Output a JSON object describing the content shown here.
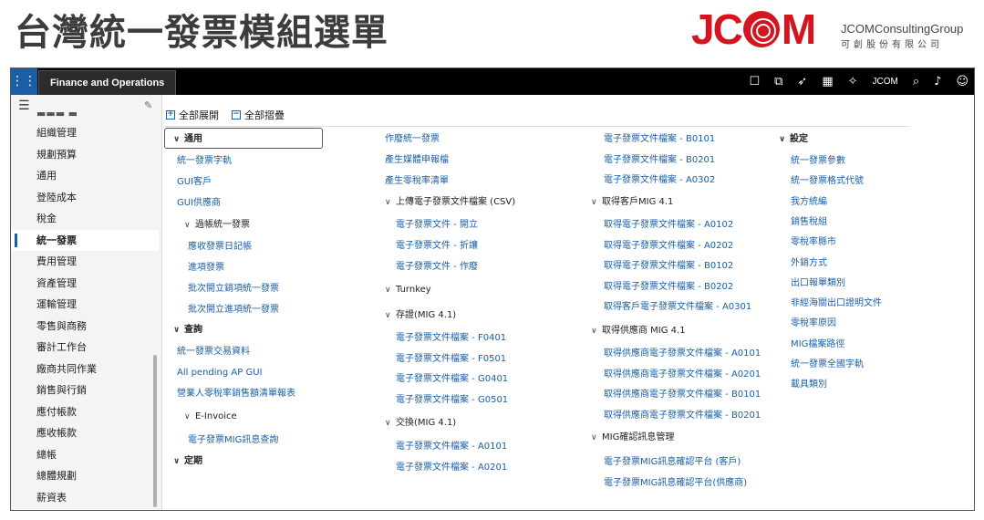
{
  "slide": {
    "title": "台灣統一發票模組選單",
    "logo_text": "JCOM",
    "logo_name": "JCOMConsultingGroup",
    "logo_sub": "可創股份有限公司"
  },
  "topbar": {
    "app_name": "Finance and Operations",
    "company": "JCOM",
    "icons": [
      "window-icon",
      "duplicate-icon",
      "rocket-icon",
      "calculator-icon",
      "wand-icon",
      "search-icon",
      "bell-icon",
      "smiley-icon"
    ]
  },
  "sidebar": {
    "items": [
      "組織管理",
      "規劃預算",
      "通用",
      "登陸成本",
      "稅金",
      "統一發票",
      "費用管理",
      "資產管理",
      "運輸管理",
      "零售與商務",
      "審計工作台",
      "廠商共同作業",
      "銷售與行銷",
      "應付帳款",
      "應收帳款",
      "總帳",
      "總體規劃",
      "薪資表"
    ],
    "active": "統一發票"
  },
  "toolbar": {
    "expand_all": "全部展開",
    "collapse_all": "全部摺疊"
  },
  "menu": {
    "col1": {
      "general": "通用",
      "items": [
        "統一發票字軌",
        "GUI客戶",
        "GUI供應商"
      ],
      "posting": "過帳統一發票",
      "posting_items": [
        "應收發票日記帳",
        "進項發票",
        "批次開立銷項統一發票",
        "批次開立進項統一發票"
      ],
      "inquiry": "查詢",
      "inquiry_items": [
        "統一發票交易資料",
        "All pending AP GUI",
        "營業人零稅率銷售額清單報表"
      ],
      "einvoice": "E-Invoice",
      "einvoice_items": [
        "電子發票MIG訊息查詢"
      ],
      "periodic": "定期"
    },
    "col2": {
      "items": [
        "作廢統一發票",
        "產生媒體申報檔",
        "產生零稅率清單"
      ],
      "upload": "上傳電子發票文件檔案 (CSV)",
      "upload_items": [
        "電子發票文件 - 開立",
        "電子發票文件 - 折讓",
        "電子發票文件 - 作廢"
      ],
      "turnkey": "Turnkey",
      "store": "存證(MIG 4.1)",
      "store_items": [
        "電子發票文件檔案 - F0401",
        "電子發票文件檔案 - F0501",
        "電子發票文件檔案 - G0401",
        "電子發票文件檔案 - G0501"
      ],
      "exchange": "交換(MIG 4.1)",
      "exchange_items": [
        "電子發票文件檔案 - A0101",
        "電子發票文件檔案 - A0201"
      ]
    },
    "col3": {
      "items": [
        "電子發票文件檔案 - B0101",
        "電子發票文件檔案 - B0201",
        "電子發票文件檔案 - A0302"
      ],
      "cust": "取得客戶MIG 4.1",
      "cust_items": [
        "取得電子發票文件檔案 - A0102",
        "取得電子發票文件檔案 - A0202",
        "取得電子發票文件檔案 - B0102",
        "取得電子發票文件檔案 - B0202",
        "取得客戶電子發票文件檔案 - A0301"
      ],
      "vend": "取得供應商 MIG 4.1",
      "vend_items": [
        "取得供應商電子發票文件檔案 - A0101",
        "取得供應商電子發票文件檔案 - A0201",
        "取得供應商電子發票文件檔案 - B0101",
        "取得供應商電子發票文件檔案 - B0201"
      ],
      "confirm": "MIG確認訊息管理",
      "confirm_items": [
        "電子發票MIG訊息確認平台 (客戶)",
        "電子發票MIG訊息確認平台(供應商)"
      ]
    },
    "col4": {
      "setup": "設定",
      "items": [
        "統一發票參數",
        "統一發票格式代號",
        "我方統編",
        "銷售稅組",
        "零稅率縣市",
        "外銷方式",
        "出口報單類別",
        "非經海關出口證明文件",
        "零稅率原因",
        "MIG檔案路徑",
        "統一發票全國字軌",
        "載具類別"
      ]
    }
  }
}
